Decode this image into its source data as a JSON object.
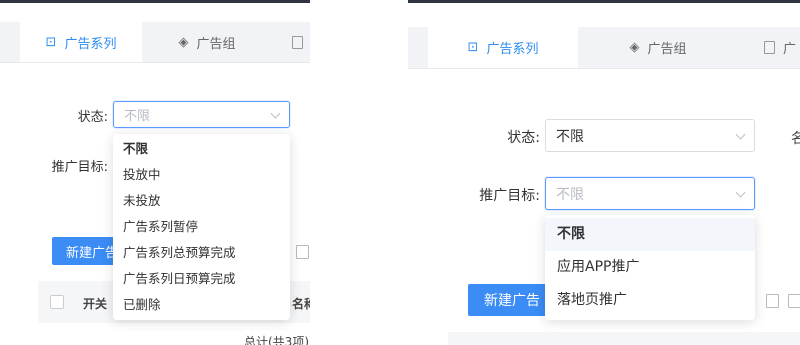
{
  "left": {
    "tabs": [
      {
        "label": "广告系列",
        "icon": "campaign-icon"
      },
      {
        "label": "广告组",
        "icon": "layers-icon"
      }
    ],
    "status_label": "状态:",
    "status_placeholder": "不限",
    "target_label": "推广目标:",
    "new_button": "新建广告",
    "col_switch": "开关",
    "col_name": "名称",
    "footer_total": "总计(共3项)",
    "status_options": [
      "不限",
      "投放中",
      "未投放",
      "广告系列暂停",
      "广告系列总预算完成",
      "广告系列日预算完成",
      "已删除"
    ]
  },
  "right": {
    "tabs": [
      {
        "label": "广告系列",
        "icon": "campaign-icon"
      },
      {
        "label": "广告组",
        "icon": "layers-icon"
      },
      {
        "label": "广",
        "icon": "doc-icon"
      }
    ],
    "status_label": "状态:",
    "status_value": "不限",
    "target_label": "推广目标:",
    "target_placeholder": "不限",
    "new_button": "新建广告",
    "target_options": [
      "不限",
      "应用APP推广",
      "落地页推广"
    ],
    "cut_char": "名"
  },
  "colors": {
    "accent": "#2d8cf0",
    "primary_button": "#3b8cf5",
    "focus_border": "#5b9bff"
  }
}
